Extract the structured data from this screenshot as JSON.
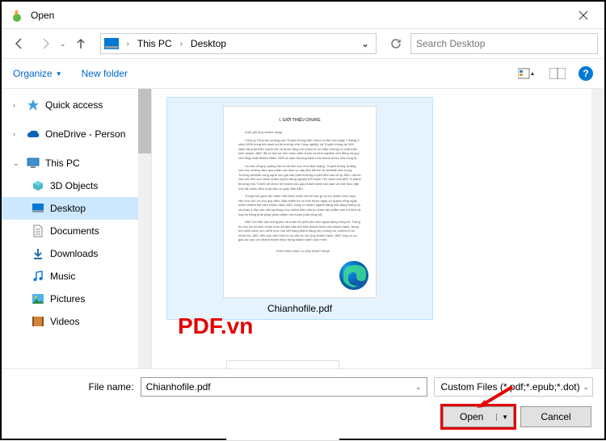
{
  "window": {
    "title": "Open"
  },
  "breadcrumb": {
    "loc1": "This PC",
    "loc2": "Desktop"
  },
  "search": {
    "placeholder": "Search Desktop"
  },
  "toolbar": {
    "organize": "Organize",
    "newfolder": "New folder"
  },
  "sidebar": {
    "quick_access": "Quick access",
    "onedrive": "OneDrive - Person",
    "this_pc": "This PC",
    "objects3d": "3D Objects",
    "desktop": "Desktop",
    "documents": "Documents",
    "downloads": "Downloads",
    "music": "Music",
    "pictures": "Pictures",
    "videos": "Videos"
  },
  "file": {
    "name": "Chianhofile.pdf",
    "thumb_title": "I. GIỚI THIỆU CHUNG"
  },
  "watermark": "PDF.vn",
  "footer": {
    "filename_label": "File name:",
    "filename_value": "Chianhofile.pdf",
    "filter": "Custom Files (*.pdf;*.epub;*.dot)",
    "open": "Open",
    "cancel": "Cancel"
  }
}
